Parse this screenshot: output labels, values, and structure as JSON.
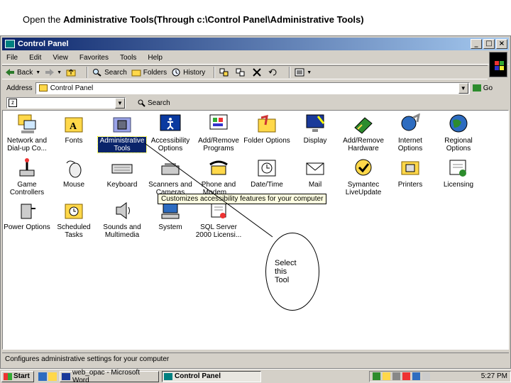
{
  "instruction": {
    "prefix": "Open the ",
    "bold": "Administrative Tools(Through c:\\Control Panel\\Administrative Tools)"
  },
  "window": {
    "title": "Control Panel",
    "buttons": [
      "_",
      "□",
      "×"
    ],
    "menu": [
      "File",
      "Edit",
      "View",
      "Favorites",
      "Tools",
      "Help"
    ],
    "toolbar": [
      "Back",
      "Search",
      "Folders",
      "History"
    ],
    "address_label": "Address",
    "address_value": "Control Panel",
    "go_label": "Go",
    "search_label": "Search"
  },
  "items": [
    {
      "label": "Network and Dial-up Co...",
      "icon": "network-icon"
    },
    {
      "label": "Fonts",
      "icon": "fonts-icon"
    },
    {
      "label": "Administrative Tools",
      "icon": "admin-tools-icon"
    },
    {
      "label": "Accessibility Options",
      "icon": "accessibility-icon"
    },
    {
      "label": "Add/Remove Programs",
      "icon": "add-remove-icon"
    },
    {
      "label": "Folder Options",
      "icon": "folder-options-icon"
    },
    {
      "label": "Display",
      "icon": "display-icon"
    },
    {
      "label": "Add/Remove Hardware",
      "icon": "hardware-icon"
    },
    {
      "label": "Internet Options",
      "icon": "internet-icon"
    },
    {
      "label": "Regional Options",
      "icon": "globe-icon"
    },
    {
      "label": "Game Controllers",
      "icon": "joystick-icon"
    },
    {
      "label": "Mouse",
      "icon": "mouse-icon"
    },
    {
      "label": "Keyboard",
      "icon": "keyboard-icon"
    },
    {
      "label": "Scanners and Cameras",
      "icon": "scanner-icon"
    },
    {
      "label": "Phone and Modem ...",
      "icon": "phone-icon"
    },
    {
      "label": "Date/Time",
      "icon": "clock-icon"
    },
    {
      "label": "Mail",
      "icon": "mail-icon"
    },
    {
      "label": "Symantec LiveUpdate",
      "icon": "liveupdate-icon"
    },
    {
      "label": "Printers",
      "icon": "printer-icon"
    },
    {
      "label": "Licensing",
      "icon": "licensing-icon"
    },
    {
      "label": "Power Options",
      "icon": "power-icon"
    },
    {
      "label": "Scheduled Tasks",
      "icon": "tasks-icon"
    },
    {
      "label": "Sounds and Multimedia",
      "icon": "speaker-icon"
    },
    {
      "label": "System",
      "icon": "computer-icon"
    },
    {
      "label": "SQL Server 2000 Licensi...",
      "icon": "sql-icon"
    }
  ],
  "tooltip": "Customizes accessibility features for your computer",
  "callout": [
    "Select",
    "this",
    "Tool"
  ],
  "status": "Configures administrative settings for your computer",
  "taskbar": {
    "start": "Start",
    "tasks": [
      "web_opac - Microsoft Word",
      "Control Panel"
    ],
    "clock": "5:27 PM"
  },
  "colors": {
    "title_bar": "#0a246a",
    "selection": "#0a246a",
    "chrome": "#d4d0c8"
  }
}
